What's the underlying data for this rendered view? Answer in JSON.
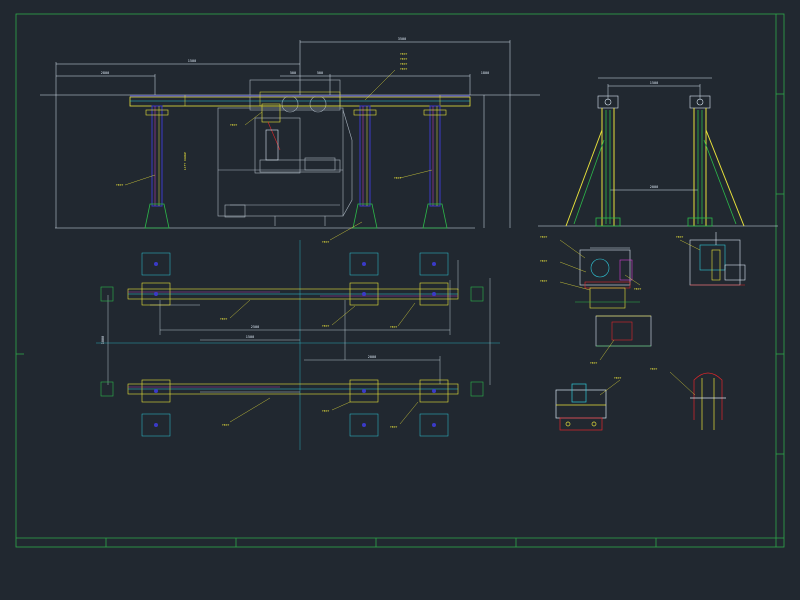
{
  "drawing": {
    "colors": {
      "background": "#212830",
      "frame": "#2ea84a",
      "dimension": "#d8e4f0",
      "column": "#3a3ac8",
      "gantry": "#e8e13a",
      "steel": "#2cb84a",
      "machine": "#a9b4bf",
      "label": "#e8e13a",
      "detail_red": "#e0262a",
      "detail_cyan": "#2fc7d8",
      "detail_magenta": "#d23cd2"
    },
    "labels": {
      "top_dim": "3500",
      "left_dim": "1500",
      "mid_dim": "2800",
      "right_dim": "1800",
      "small_dim_a": "500",
      "small_dim_b": "500",
      "callout_top_1": "TEXT",
      "callout_top_2": "TEXT",
      "callout_top_3": "TEXT",
      "callout_top_4": "TEXT",
      "callout_col_1": "TEXT",
      "callout_col_2": "TEXT",
      "callout_col_3": "TEXT",
      "callout_mid": "TEXT",
      "vertical_note": "LIFT RANGE",
      "side_top_dim": "1500",
      "side_mid_dim": "2000",
      "plan_dim_1": "2500",
      "plan_dim_2": "1500",
      "plan_dim_3": "2000",
      "plan_dim_4": "1800",
      "plan_note_1": "TEXT",
      "plan_note_2": "TEXT",
      "plan_note_3": "TEXT",
      "plan_note_4": "TEXT",
      "plan_note_5": "TEXT",
      "plan_note_6": "TEXT",
      "detail_note_1": "TEXT",
      "detail_note_2": "TEXT",
      "detail_note_3": "TEXT",
      "detail_note_4": "TEXT",
      "detail_note_5": "TEXT",
      "detail_note_6": "TEXT",
      "detail_note_7": "TEXT",
      "detail_note_8": "TEXT"
    }
  }
}
